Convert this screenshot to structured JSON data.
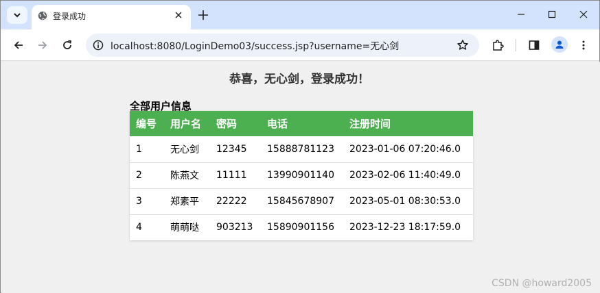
{
  "browser": {
    "tab_title": "登录成功",
    "address_url": "localhost:8080/LoginDemo03/success.jsp?username=无心剑"
  },
  "page": {
    "heading": "恭喜，无心剑，登录成功！",
    "section_title": "全部用户信息",
    "table": {
      "headers": [
        "编号",
        "用户名",
        "密码",
        "电话",
        "注册时间"
      ],
      "rows": [
        [
          "1",
          "无心剑",
          "12345",
          "15888781123",
          "2023-01-06 07:20:46.0"
        ],
        [
          "2",
          "陈燕文",
          "11111",
          "13990901140",
          "2023-02-06 11:40:49.0"
        ],
        [
          "3",
          "郑素平",
          "22222",
          "15845678907",
          "2023-05-01 08:30:53.0"
        ],
        [
          "4",
          "萌萌哒",
          "903213",
          "15890901156",
          "2023-12-23 18:17:59.0"
        ]
      ]
    },
    "watermark": "CSDN @howard2005"
  },
  "colors": {
    "header_bg": "#4caf50",
    "tabstrip_bg": "#d3e3fd",
    "page_bg": "#f0f0f0"
  },
  "icons": [
    "tab-search-icon",
    "globe-icon",
    "close-icon",
    "plus-icon",
    "minimize-icon",
    "maximize-icon",
    "back-icon",
    "forward-icon",
    "reload-icon",
    "info-icon",
    "star-icon",
    "extensions-icon",
    "sidepanel-icon",
    "profile-icon",
    "more-icon"
  ]
}
